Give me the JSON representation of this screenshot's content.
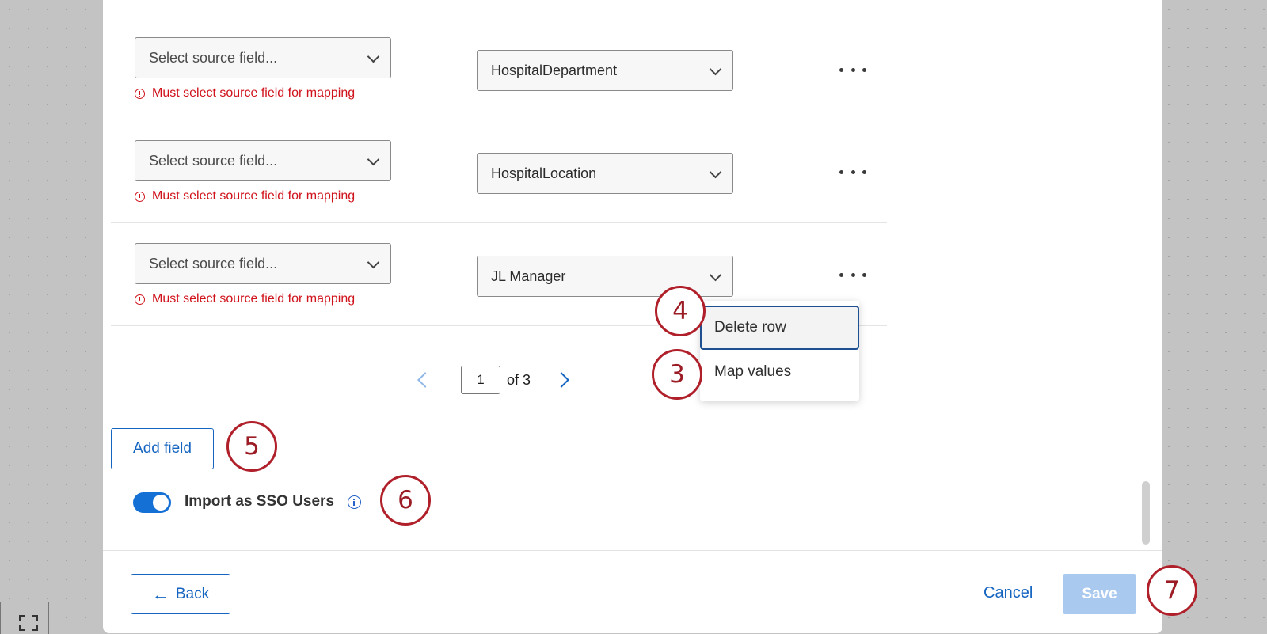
{
  "rows": [
    {
      "source_placeholder": "Select source field...",
      "error": "Must select source field for mapping",
      "target_value": "HospitalDepartment"
    },
    {
      "source_placeholder": "Select source field...",
      "error": "Must select source field for mapping",
      "target_value": "HospitalLocation"
    },
    {
      "source_placeholder": "Select source field...",
      "error": "Must select source field for mapping",
      "target_value": "JL Manager"
    }
  ],
  "pagination": {
    "current_page": "1",
    "of_label": "of 3"
  },
  "row_menu": {
    "items": [
      "Delete row",
      "Map values"
    ]
  },
  "buttons": {
    "add_field": "Add field",
    "back": "Back",
    "cancel": "Cancel",
    "save": "Save"
  },
  "sso_toggle": {
    "label": "Import as SSO Users",
    "enabled": true
  },
  "callouts": [
    "4",
    "3",
    "5",
    "6",
    "7"
  ],
  "colors": {
    "primary": "#1565c0",
    "error": "#d0121b",
    "callout": "#b0202a",
    "save_disabled": "#a9c9ef"
  }
}
